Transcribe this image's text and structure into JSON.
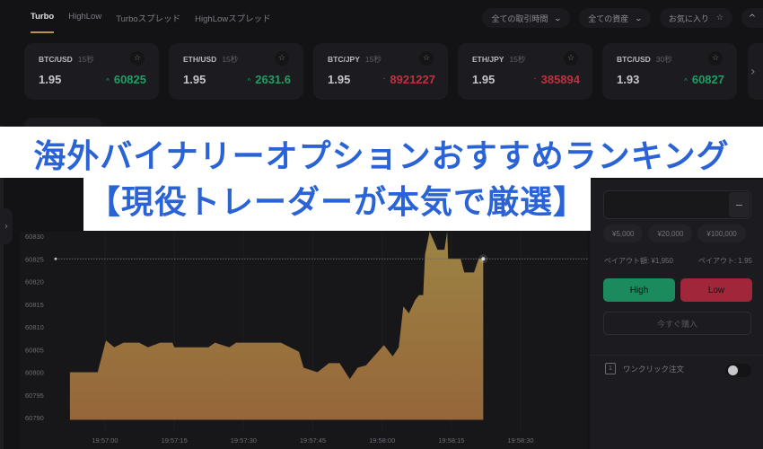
{
  "tabs": [
    {
      "label": "Turbo",
      "active": true
    },
    {
      "label": "HighLow",
      "active": false
    },
    {
      "label": "Turboスプレッド",
      "active": false
    },
    {
      "label": "HighLowスプレッド",
      "active": false
    }
  ],
  "filters": {
    "trading_hours": "全ての取引時間",
    "assets": "全ての資産",
    "favorites": "お気に入り",
    "chevron_down": "⌄",
    "star": "☆",
    "collapse": "^"
  },
  "cards": [
    {
      "pair": "BTC/USD",
      "duration": "15秒",
      "payout": "1.95",
      "price": "60825",
      "direction": "up",
      "arrow": "^"
    },
    {
      "pair": "ETH/USD",
      "duration": "15秒",
      "payout": "1.95",
      "price": "2631.6",
      "direction": "up",
      "arrow": "^"
    },
    {
      "pair": "BTC/JPY",
      "duration": "15秒",
      "payout": "1.95",
      "price": "8921227",
      "direction": "down",
      "arrow": "ˇ"
    },
    {
      "pair": "ETH/JPY",
      "duration": "15秒",
      "payout": "1.95",
      "price": "385894",
      "direction": "down",
      "arrow": "ˇ"
    },
    {
      "pair": "BTC/USD",
      "duration": "30秒",
      "payout": "1.93",
      "price": "60827",
      "direction": "up",
      "arrow": "^"
    }
  ],
  "cards_next": "›",
  "sidebar_expand": "›",
  "banner": {
    "line1": "海外バイナリーオプションおすすめランキング",
    "line2": "【現役トレーダーが本気で厳選】",
    "color": "#2a63d6"
  },
  "trade_panel": {
    "minus": "−",
    "presets": [
      "¥5,000",
      "¥20,000",
      "¥100,000"
    ],
    "payout_amount": "ペイアウト額: ¥1,950",
    "payout_rate": "ペイアウト: 1.95",
    "high_label": "High",
    "low_label": "Low",
    "buy_now": "今すぐ購入",
    "one_click_label": "ワンクリック注文",
    "one_click_icon": "1",
    "one_click_enabled": false
  },
  "colors": {
    "up": "#1f9d63",
    "down": "#c0303f",
    "accent": "#b8924f",
    "area_top": "#9c8444",
    "area_bottom": "#966639"
  },
  "chart_data": {
    "type": "area",
    "title": "",
    "xlabel": "",
    "ylabel": "",
    "y_ticks": [
      60830,
      60825,
      60820,
      60815,
      60810,
      60805,
      60800,
      60795,
      60790
    ],
    "x_ticks": [
      "19:57:00",
      "19:57:15",
      "19:57:30",
      "19:57:45",
      "19:58:00",
      "19:58:15",
      "19:58:30"
    ],
    "x_tick_seconds": [
      0,
      15,
      30,
      45,
      60,
      75,
      90
    ],
    "ylim": [
      60788.5,
      60834
    ],
    "xlim_seconds": [
      -11.5,
      97
    ],
    "current_price": 60825,
    "series": [
      {
        "name": "BTC/USD",
        "x_seconds": [
          -7.6,
          -1.6,
          0.2,
          2,
          4,
          7.4,
          9.3,
          11.9,
          14.6,
          15,
          22.4,
          23.8,
          26.9,
          28.4,
          38.1,
          42,
          43,
          46,
          48.5,
          50.8,
          53,
          54.7,
          56.5,
          60.4,
          62.3,
          63.6,
          64.6,
          65.8,
          67.2,
          68,
          68.9,
          69.3,
          70.3,
          72,
          73.5,
          74.1,
          74.3,
          77,
          77.8,
          79.9,
          80.9,
          81.9
        ],
        "values": [
          60800,
          60800,
          60807,
          60805.5,
          60806.5,
          60806.5,
          60805.5,
          60806.5,
          60806.5,
          60805.5,
          60805.5,
          60806.5,
          60805.5,
          60806.5,
          60806.5,
          60804.5,
          60801,
          60800,
          60802,
          60802,
          60798.5,
          60801,
          60801.5,
          60806,
          60803.5,
          60805.5,
          60814.5,
          60813,
          60816,
          60817,
          60817,
          60826,
          60831,
          60827,
          60827,
          60831,
          60825,
          60825,
          60822,
          60822,
          60825,
          60825
        ]
      }
    ]
  }
}
